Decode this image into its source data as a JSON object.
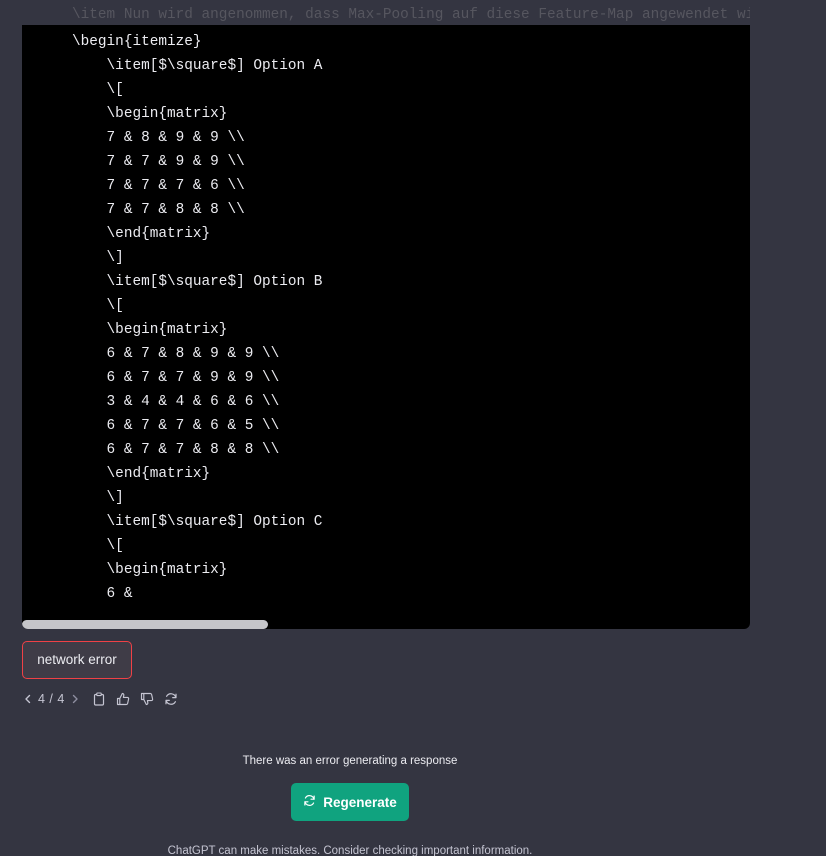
{
  "code": {
    "faded_line": "\\item Nun wird angenommen, dass Max-Pooling auf diese Feature-Map angewendet wird",
    "lines": [
      "\\begin{itemize}",
      "    \\item[$\\square$] Option A",
      "    \\[",
      "    \\begin{matrix}",
      "    7 & 8 & 9 & 9 \\\\",
      "    7 & 7 & 9 & 9 \\\\",
      "    7 & 7 & 7 & 6 \\\\",
      "    7 & 7 & 8 & 8 \\\\",
      "    \\end{matrix}",
      "    \\]",
      "    \\item[$\\square$] Option B",
      "    \\[",
      "    \\begin{matrix}",
      "    6 & 7 & 8 & 9 & 9 \\\\",
      "    6 & 7 & 7 & 9 & 9 \\\\",
      "    3 & 4 & 4 & 6 & 6 \\\\",
      "    6 & 7 & 7 & 6 & 5 \\\\",
      "    6 & 7 & 7 & 8 & 8 \\\\",
      "    \\end{matrix}",
      "    \\]",
      "    \\item[$\\square$] Option C",
      "    \\[",
      "    \\begin{matrix}",
      "    6 &"
    ]
  },
  "error_badge": {
    "label": "network error",
    "border_color": "#ef4146"
  },
  "actions": {
    "pager": "4 / 4",
    "prev_icon": "chevron-left-icon",
    "next_icon": "chevron-right-icon",
    "icons": [
      "clipboard-icon",
      "thumbs-up-icon",
      "thumbs-down-icon",
      "refresh-icon"
    ]
  },
  "status": {
    "error_message": "There was an error generating a response",
    "regenerate_label": "Regenerate",
    "regenerate_icon": "refresh-icon",
    "disclaimer": "ChatGPT can make mistakes. Consider checking important information."
  },
  "colors": {
    "background": "#343541",
    "code_background": "#000000",
    "accent": "#10a37f"
  }
}
